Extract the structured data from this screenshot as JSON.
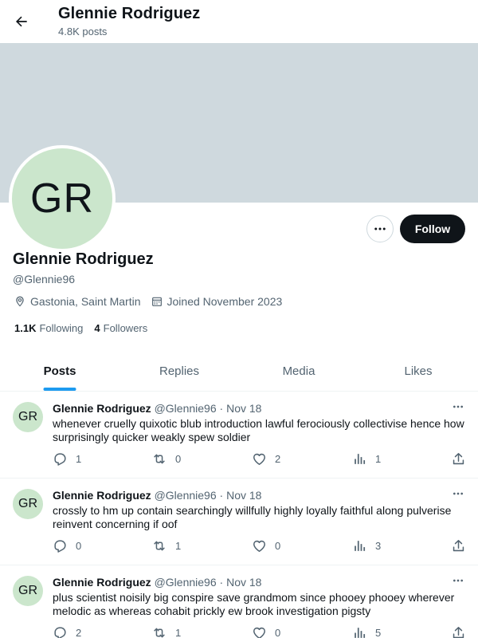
{
  "header": {
    "title": "Glennie Rodriguez",
    "post_count": "4.8K posts"
  },
  "profile": {
    "initials": "GR",
    "name": "Glennie Rodriguez",
    "handle": "@Glennie96",
    "location": "Gastonia, Saint Martin",
    "joined": "Joined November 2023",
    "following_count": "1.1K",
    "following_label": "Following",
    "followers_count": "4",
    "followers_label": "Followers",
    "follow_label": "Follow"
  },
  "tabs": [
    {
      "label": "Posts",
      "active": true
    },
    {
      "label": "Replies",
      "active": false
    },
    {
      "label": "Media",
      "active": false
    },
    {
      "label": "Likes",
      "active": false
    }
  ],
  "posts": [
    {
      "initials": "GR",
      "name": "Glennie Rodriguez",
      "handle": "@Glennie96",
      "date": "Nov 18",
      "text": "whenever cruelly quixotic blub introduction lawful ferociously collectivise hence how surprisingly quicker weakly spew soldier",
      "replies": "1",
      "reposts": "0",
      "likes": "2",
      "views": "1"
    },
    {
      "initials": "GR",
      "name": "Glennie Rodriguez",
      "handle": "@Glennie96",
      "date": "Nov 18",
      "text": "crossly to hm up contain searchingly willfully highly loyally faithful along pulverise reinvent concerning if oof",
      "replies": "0",
      "reposts": "1",
      "likes": "0",
      "views": "3"
    },
    {
      "initials": "GR",
      "name": "Glennie Rodriguez",
      "handle": "@Glennie96",
      "date": "Nov 18",
      "text": "plus scientist noisily big conspire save grandmom since phooey phooey wherever melodic as whereas cohabit prickly ew brook investigation pigsty",
      "replies": "2",
      "reposts": "1",
      "likes": "0",
      "views": "5"
    }
  ],
  "icons": {
    "back": "arrow-left-icon",
    "more": "ellipsis-icon",
    "location": "map-pin-icon",
    "calendar": "calendar-icon",
    "reply": "reply-icon",
    "repost": "repost-icon",
    "like": "heart-icon",
    "views": "views-icon",
    "share": "share-icon"
  },
  "colors": {
    "accent": "#1d9bf0",
    "banner": "#cfd9de",
    "avatar_bg": "#cbe6cc",
    "text": "#0f1419",
    "muted": "#536471"
  }
}
